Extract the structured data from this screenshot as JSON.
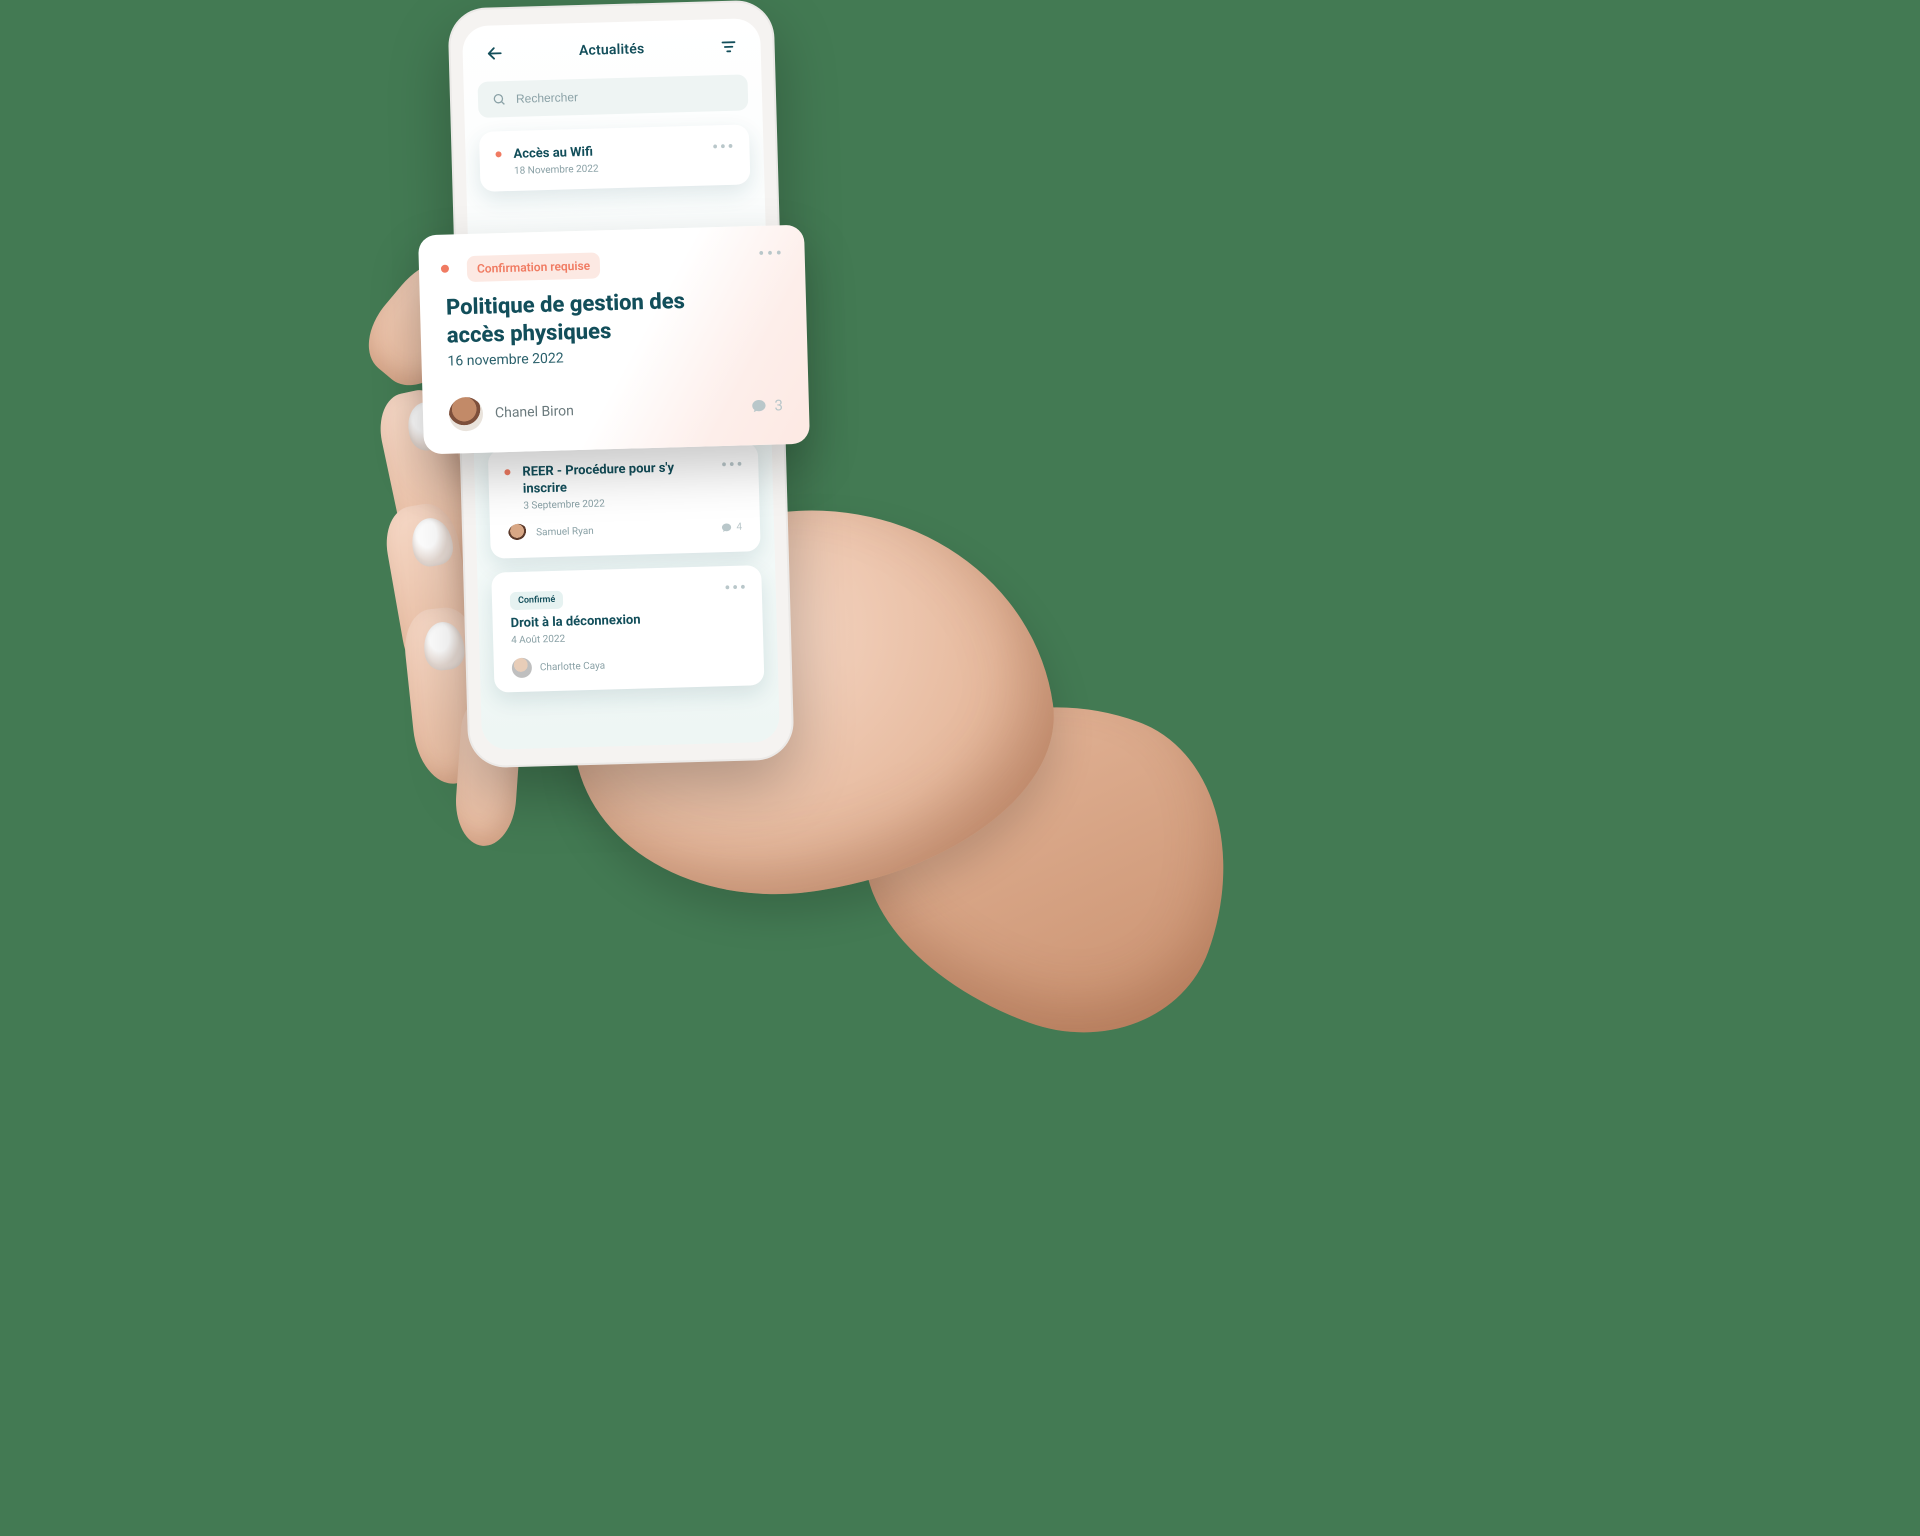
{
  "colors": {
    "teal": "#124e5a",
    "coral": "#f07b62",
    "background": "#437a53"
  },
  "header": {
    "title": "Actualités",
    "back_label": "Retour",
    "filter_label": "Filtrer"
  },
  "search": {
    "placeholder": "Rechercher"
  },
  "featured": {
    "badge": "Confirmation requise",
    "title": "Politique de gestion des accès physiques",
    "date": "16 novembre 2022",
    "author": "Chanel Biron",
    "comments": "3",
    "more_label": "•••"
  },
  "feed": [
    {
      "title": "Accès au Wifi",
      "date": "18 Novembre 2022",
      "more_label": "•••"
    },
    {
      "title": "REER - Procédure pour s'y inscrire",
      "date": "3 Septembre 2022",
      "author": "Samuel Ryan",
      "comments": "4",
      "more_label": "•••"
    },
    {
      "badge": "Confirmé",
      "title": "Droit à la déconnexion",
      "date": "4 Août 2022",
      "author": "Charlotte Caya",
      "more_label": "•••"
    }
  ]
}
